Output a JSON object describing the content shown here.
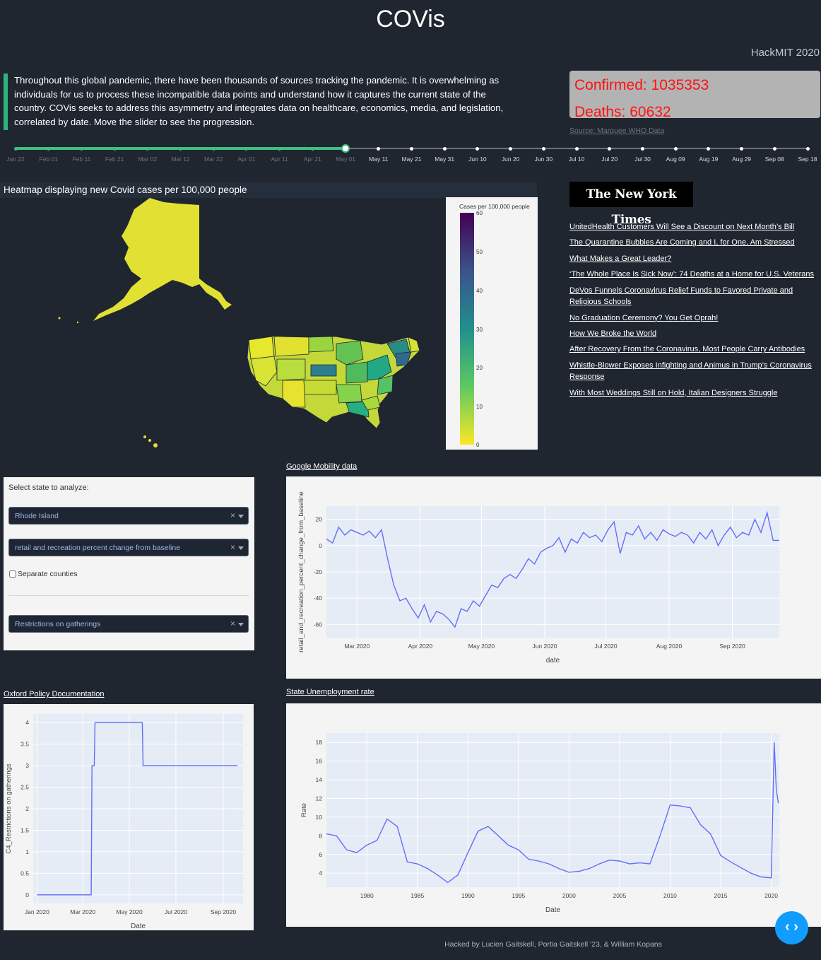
{
  "header": {
    "title": "COVis",
    "subtitle": "HackMIT 2020"
  },
  "intro": {
    "text": "Throughout this global pandemic, there have been thousands of sources tracking the pandemic. It is overwhelming as individuals for us to process these incompatible data points and understand how it captures the current state of the country. COVis seeks to address this asymmetry and integrates data on healthcare, economics, media, and legislation, correlated by date. Move the slider to see the progression."
  },
  "stats": {
    "confirmed": "Confirmed: 1035353",
    "deaths": "Deaths: 60632",
    "source": "Source: Marquee WHO Data"
  },
  "slider": {
    "marks": [
      "Jan 22",
      "Feb 01",
      "Feb 11",
      "Feb 21",
      "Mar 02",
      "Mar 12",
      "Mar 22",
      "Apr 01",
      "Apr 11",
      "Apr 21",
      "May 01",
      "May 11",
      "May 21",
      "May 31",
      "Jun 10",
      "Jun 20",
      "Jun 30",
      "Jul 10",
      "Jul 20",
      "Jul 30",
      "Aug 09",
      "Aug 19",
      "Aug 29",
      "Sep 08",
      "Sep 18"
    ],
    "selected_index": 10,
    "selected_label": "May 01"
  },
  "map": {
    "title": "Heatmap displaying new Covid cases per 100,000 people",
    "colorbar_title": "Cases per 100,000 people",
    "colorbar_ticks": [
      "60",
      "50",
      "40",
      "30",
      "20",
      "10",
      "0"
    ],
    "colorscale": [
      "#440154",
      "#3b528b",
      "#21908d",
      "#5dc962",
      "#fde725"
    ]
  },
  "news": {
    "logo": "The New York Times",
    "headlines": [
      "UnitedHealth Customers Will See a Discount on Next Month’s Bill",
      "The Quarantine Bubbles Are Coming and I, for One, Am Stressed",
      "What Makes a Great Leader?",
      "‘The Whole Place Is Sick Now’: 74 Deaths at a Home for U.S. Veterans",
      "DeVos Funnels Coronavirus Relief Funds to Favored Private and Religious Schools",
      "No Graduation Ceremony? You Get Oprah!",
      "How We Broke the World",
      "After Recovery From the Coronavirus, Most People Carry Antibodies",
      "Whistle-Blower Exposes Infighting and Animus in Trump’s Coronavirus Response",
      "With Most Weddings Still on Hold, Italian Designers Struggle"
    ]
  },
  "controls": {
    "label": "Select state to analyze:",
    "state_value": "Rhode Island",
    "mobility_value": "retail and recreation percent change from baseline",
    "separate_label": "Separate counties",
    "separate_checked": false,
    "policy_value": "Restrictions on gatherings"
  },
  "charts": {
    "mobility_title": "Google Mobility data",
    "policy_title": "Oxford Policy Documentation",
    "unemployment_title": "State Unemployment rate"
  },
  "footer": {
    "text": "Hacked by Lucien Gaitskell, Portia Gaitskell '23, & William Kopans"
  },
  "colors": {
    "background": "#1f2630",
    "accent": "#3fbf83",
    "stat_text": "#ff1212",
    "line": "#636efa",
    "plot_bg": "#e5ecf6"
  },
  "icons": {
    "code_toggle": "code-brackets-icon"
  },
  "chart_data": [
    {
      "type": "line",
      "xlabel": "date",
      "ylabel": "retail_and_recreation_percent_change_from_baseline",
      "xticks": [
        "Mar 2020",
        "Apr 2020",
        "May 2020",
        "Jun 2020",
        "Jul 2020",
        "Aug 2020",
        "Sep 2020"
      ],
      "yticks": [
        20,
        0,
        -20,
        -40,
        -60
      ],
      "ylim": [
        -70,
        30
      ],
      "x_start": "2020-02-15",
      "x": [
        0,
        3,
        6,
        9,
        12,
        15,
        18,
        21,
        24,
        27,
        30,
        33,
        36,
        39,
        42,
        45,
        48,
        51,
        54,
        57,
        60,
        63,
        66,
        69,
        72,
        75,
        78,
        81,
        84,
        87,
        90,
        93,
        96,
        99,
        102,
        105,
        108,
        111,
        114,
        117,
        120,
        123,
        126,
        129,
        132,
        135,
        138,
        141,
        144,
        147,
        150,
        153,
        156,
        159,
        162,
        165,
        168,
        171,
        174,
        177,
        180,
        183,
        186,
        189,
        192,
        195,
        198,
        201,
        204,
        207,
        210,
        213,
        216,
        219,
        222
      ],
      "values": [
        5,
        2,
        14,
        8,
        12,
        10,
        8,
        11,
        6,
        12,
        -10,
        -30,
        -42,
        -40,
        -48,
        -55,
        -45,
        -58,
        -50,
        -52,
        -56,
        -62,
        -48,
        -50,
        -42,
        -46,
        -38,
        -30,
        -32,
        -25,
        -22,
        -25,
        -18,
        -10,
        -14,
        -5,
        -2,
        0,
        6,
        -5,
        5,
        2,
        10,
        6,
        8,
        3,
        12,
        18,
        -6,
        10,
        8,
        15,
        5,
        10,
        4,
        12,
        9,
        7,
        10,
        8,
        2,
        10,
        5,
        12,
        0,
        8,
        14,
        6,
        10,
        8,
        20,
        10,
        25,
        4,
        4
      ],
      "grid": true
    },
    {
      "type": "line",
      "xlabel": "Date",
      "ylabel": "C4_Restrictions on gatherings",
      "xticks": [
        "Jan 2020",
        "Mar 2020",
        "May 2020",
        "Jul 2020",
        "Sep 2020"
      ],
      "yticks": [
        0,
        0.5,
        1,
        1.5,
        2,
        2.5,
        3,
        3.5,
        4
      ],
      "ylim": [
        -0.2,
        4.2
      ],
      "x": [
        "2020-01-01",
        "2020-03-12",
        "2020-03-13",
        "2020-03-16",
        "2020-03-17",
        "2020-05-18",
        "2020-05-19",
        "2020-09-20"
      ],
      "values": [
        0,
        0,
        3,
        3,
        4,
        4,
        3,
        3
      ],
      "grid": true
    },
    {
      "type": "line",
      "xlabel": "Date",
      "ylabel": "Rate",
      "xticks": [
        "1980",
        "1985",
        "1990",
        "1995",
        "2000",
        "2005",
        "2010",
        "2015",
        "2020"
      ],
      "yticks": [
        4,
        6,
        8,
        10,
        12,
        14,
        16,
        18
      ],
      "ylim": [
        2.5,
        19
      ],
      "x": [
        1976,
        1977,
        1978,
        1979,
        1980,
        1981,
        1982,
        1983,
        1984,
        1985,
        1986,
        1987,
        1988,
        1989,
        1990,
        1991,
        1992,
        1993,
        1994,
        1995,
        1996,
        1997,
        1998,
        1999,
        2000,
        2001,
        2002,
        2003,
        2004,
        2005,
        2006,
        2007,
        2008,
        2009,
        2010,
        2011,
        2012,
        2013,
        2014,
        2015,
        2016,
        2017,
        2018,
        2019,
        2020,
        2020.3,
        2020.5,
        2020.7
      ],
      "values": [
        8.2,
        8.0,
        6.5,
        6.2,
        7.0,
        7.5,
        9.8,
        9.0,
        5.2,
        5.0,
        4.5,
        3.8,
        3.0,
        3.8,
        6.2,
        8.5,
        9.0,
        8.0,
        7.0,
        6.5,
        5.5,
        5.3,
        5.0,
        4.5,
        4.1,
        4.2,
        4.5,
        5.0,
        5.4,
        5.3,
        5.0,
        5.1,
        5.0,
        8.0,
        11.3,
        11.2,
        11.0,
        9.2,
        8.2,
        5.9,
        5.2,
        4.6,
        4.0,
        3.6,
        3.5,
        18.0,
        13.0,
        11.5
      ],
      "grid": true
    }
  ]
}
